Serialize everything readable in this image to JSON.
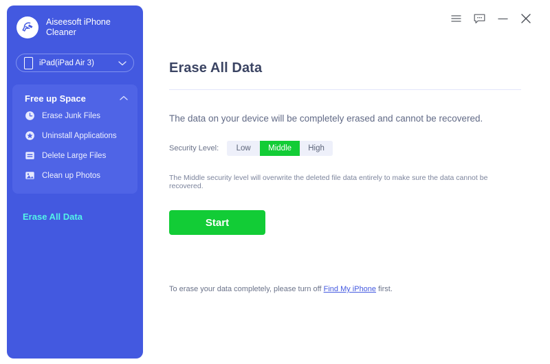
{
  "window": {
    "controls": [
      {
        "name": "menu-button",
        "icon": "hamburger-menu-icon",
        "label": "Menu"
      },
      {
        "name": "feedback-button",
        "icon": "chat-bubble-icon",
        "label": "Feedback"
      },
      {
        "name": "minimize-button",
        "icon": "minimize-icon",
        "label": "Minimize"
      },
      {
        "name": "close-button",
        "icon": "close-icon",
        "label": "Close"
      }
    ]
  },
  "sidebar": {
    "brand_name": "Aiseesoft iPhone\nCleaner",
    "logo_icon": "broom-badge-icon",
    "device": {
      "label": "iPad(iPad Air 3)",
      "icon": "ipad-device-icon",
      "caret_icon": "chevron-down-icon"
    },
    "group": {
      "title": "Free up Space",
      "chevron_icon": "chevron-up-icon",
      "items": [
        {
          "label": "Erase Junk Files",
          "icon": "clock-icon"
        },
        {
          "label": "Uninstall Applications",
          "icon": "star-circle-icon"
        },
        {
          "label": "Delete Large Files",
          "icon": "file-lines-icon"
        },
        {
          "label": "Clean up Photos",
          "icon": "photo-icon"
        }
      ]
    },
    "standalone": {
      "label": "Erase All Data",
      "active": true
    },
    "colors": {
      "panel": "#4359e0",
      "group_panel": "#4f64e6",
      "active_text": "#53f3e8"
    }
  },
  "main": {
    "title": "Erase All Data",
    "lead_text": "The data on your device will be completely erased and cannot be recovered.",
    "security": {
      "label": "Security Level:",
      "options": [
        "Low",
        "Middle",
        "High"
      ],
      "selected": "Middle"
    },
    "note_text": "The Middle security level will overwrite the deleted file data entirely to make sure the data cannot be recovered.",
    "start_label": "Start",
    "footer": {
      "prefix": "To erase your data completely, please turn off ",
      "link": "Find My iPhone",
      "suffix": " first."
    },
    "colors": {
      "accent_green": "#12cc36",
      "title": "#3b4463",
      "link": "#4359e0"
    }
  }
}
